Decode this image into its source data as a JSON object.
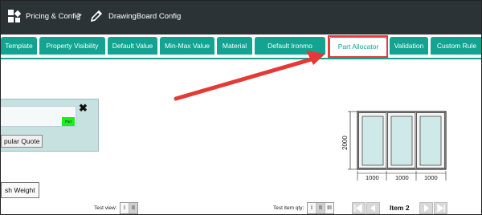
{
  "header": {
    "breadcrumb_1": "Pricing & Config",
    "separator": ">",
    "breadcrumb_2": "DrawingBoard Config"
  },
  "tabs": [
    {
      "label": "Template"
    },
    {
      "label": "Property Visibility"
    },
    {
      "label": "Default Value"
    },
    {
      "label": "Min-Max Value"
    },
    {
      "label": "Material"
    },
    {
      "label": "Default Ironmo"
    },
    {
      "label": "Part Allocator",
      "active": true
    },
    {
      "label": "Validation"
    },
    {
      "label": "Custom Rule"
    }
  ],
  "panel": {
    "close_glyph": "✖",
    "part_label": "Part",
    "quote_button": "pular Quote"
  },
  "weight_button": "sh Weight",
  "drawing": {
    "height_label": "2000",
    "widths": [
      "1000",
      "1000",
      "1000"
    ]
  },
  "test_view": {
    "label": "Test view:",
    "options": [
      "I",
      "II"
    ]
  },
  "test_qty": {
    "label": "Test item qty:",
    "options": [
      "I",
      "II",
      "III"
    ]
  },
  "pager": {
    "item_label": "Item 2"
  },
  "colors": {
    "accent": "#13a391",
    "header": "#2b3337",
    "highlight": "#e63a3a"
  }
}
